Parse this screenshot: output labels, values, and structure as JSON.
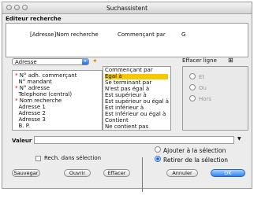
{
  "window": {
    "title": "Suchassistent"
  },
  "editor": {
    "section_label": "Editeur recherche",
    "query": {
      "field": "[Adresse]Nom recherche",
      "operator": "Commençant par",
      "value": "G"
    }
  },
  "fields_panel": {
    "table_select": "Adresse",
    "items": [
      {
        "marked": true,
        "label": "N° adh. commerçant"
      },
      {
        "marked": false,
        "label": "N° mandant"
      },
      {
        "marked": true,
        "label": "N° adresse"
      },
      {
        "marked": false,
        "label": "Telephone (central)"
      },
      {
        "marked": true,
        "label": "Nom recherche"
      },
      {
        "marked": false,
        "label": "Adresse 1"
      },
      {
        "marked": false,
        "label": "Adresse 2"
      },
      {
        "marked": false,
        "label": "Adresse 3"
      },
      {
        "marked": false,
        "label": "B. P."
      }
    ]
  },
  "operators_panel": {
    "items": [
      "Commençant par",
      "Egal à",
      "Se terminant par",
      "N'est pas égal à",
      "Est supérieur à",
      "Est supérieur ou égal à",
      "Est inférieur à",
      "Est inférieur ou égal à",
      "Contient",
      "Ne contient pas"
    ],
    "selected_index": 1
  },
  "logic": {
    "delete_line_label": "Effacer ligne",
    "options": [
      "Et",
      "Ou",
      "Hors"
    ]
  },
  "value_row": {
    "label": "Valeur",
    "value": ""
  },
  "search_in_selection": {
    "label": "Rech. dans sélection",
    "checked": false
  },
  "selection_mode": {
    "options": [
      {
        "label": "Ajouter à la sélection",
        "selected": false
      },
      {
        "label": "Retirer de la sélection",
        "selected": true
      }
    ]
  },
  "buttons": {
    "save": "Sauvegar",
    "open": "Ouvrir",
    "clear": "Effacer",
    "cancel": "Annuler",
    "ok": "OK"
  }
}
